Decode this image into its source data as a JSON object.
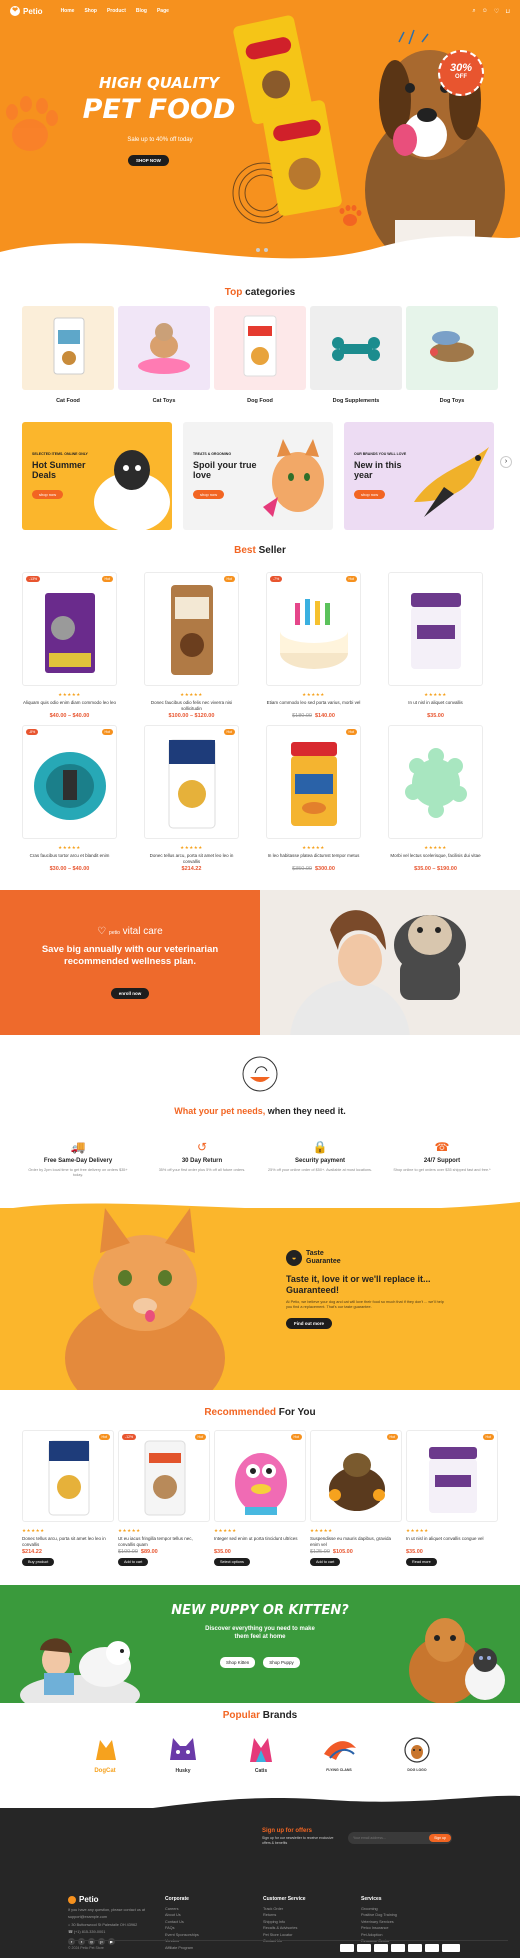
{
  "nav": {
    "logo": "Petio",
    "menu": [
      "Home",
      "Shop",
      "Product",
      "Blog",
      "Page"
    ]
  },
  "hero": {
    "title_line1": "HIGH QUALITY",
    "title_line2": "PET FOOD",
    "subtitle": "Sale up to 40% off today",
    "button": "Shop now",
    "badge_percent": "30%",
    "badge_off": "OFF"
  },
  "categories": {
    "title_orange": "Top",
    "title_dark": "categories",
    "items": [
      {
        "label": "Cat Food",
        "color": "#fbeed9"
      },
      {
        "label": "Cat Toys",
        "color": "#f1e6f7"
      },
      {
        "label": "Dog Food",
        "color": "#fde8e9"
      },
      {
        "label": "Dog Supplements",
        "color": "#eeeeee"
      },
      {
        "label": "Dog Toys",
        "color": "#e6f4ea"
      }
    ]
  },
  "banners": [
    {
      "small": "Selected items. Online only",
      "big": "Hot Summer Deals",
      "button": "shop now",
      "color": "#fbb62c"
    },
    {
      "small": "Treats & Grooming",
      "big": "Spoil your true love",
      "button": "shop now",
      "color": "#f3f3f3"
    },
    {
      "small": "Our brands you will love",
      "big": "New in this year",
      "button": "shop now",
      "color": "#eddcf3"
    }
  ],
  "best_seller": {
    "title_orange": "Best",
    "title_dark": "Seller",
    "products": [
      {
        "name": "Aliquam quis odio enim diam commodo leo leo",
        "price": "$40.00 – $40.00",
        "tagL": "-13%",
        "tagR": "Hot"
      },
      {
        "name": "Donec faucibus odio felis nec viverra nisi sollicitudin",
        "price": "$100.00 – $120.00",
        "tagL": "",
        "tagR": "Hot"
      },
      {
        "name": "Etiam commodo leo sed porta varius, morbi vel",
        "old": "$180.00",
        "price": "$140.00",
        "tagL": "-7%",
        "tagR": "Hot"
      },
      {
        "name": "In ut nisl in aliquet convallis",
        "price": "$35.00",
        "tagL": "",
        "tagR": ""
      },
      {
        "name": "Cras faucibus tortor arcu et blandit enim",
        "price": "$30.00 – $40.00",
        "tagL": "-8%",
        "tagR": "Hot"
      },
      {
        "name": "Donec tellus arcu, porta sit amet leo leo in convallis",
        "price": "$214.22",
        "tagL": "",
        "tagR": "Hot"
      },
      {
        "name": "In leo habitasse platea dictumst tempor metus",
        "old": "$350.00",
        "price": "$300.00",
        "tagL": "",
        "tagR": "Hot"
      },
      {
        "name": "Morbi vel lectus scelerisque, facilisis dui vitae",
        "price": "$35.00 – $190.00",
        "tagL": "",
        "tagR": ""
      }
    ]
  },
  "vital": {
    "brand_prefix": "petio",
    "brand": "vital care",
    "text": "Save big annually with our veterinarian recommended wellness plan.",
    "button": "enroll now"
  },
  "needs": {
    "title_orange": "What your pet needs,",
    "title_dark": "when they need it.",
    "features": [
      {
        "icon": "truck-icon",
        "glyph": "🚚",
        "title": "Free Same-Day Delivery",
        "desc": "Order by 2pm local time to get free delivery on orders $35+ today."
      },
      {
        "icon": "return-icon",
        "glyph": "↺",
        "title": "30 Day Return",
        "desc": "35% off your first order plus 5% off all future orders."
      },
      {
        "icon": "lock-icon",
        "glyph": "🔒",
        "title": "Security payment",
        "desc": "25% off your online order of $50+. Available at most locations."
      },
      {
        "icon": "support-icon",
        "glyph": "☎",
        "title": "24/7 Support",
        "desc": "Shop online to get orders over $35 shipped fast and free.*"
      }
    ]
  },
  "taste": {
    "label1": "Taste",
    "label2": "Guarantee",
    "headline": "Taste it, love it or we'll replace it... Guaranteed!",
    "text": "At Petio, we believe your dog and cat will love their food so much that if they don't ... we'll help you find a replacement. That's our taste guarantee.",
    "button": "Find out more"
  },
  "recommended": {
    "title_orange": "Recommended",
    "title_dark": "For You",
    "products": [
      {
        "name": "Donec tellus arcu, porta sit amet leo leo in convallis",
        "price": "$214.22",
        "button": "Buy product",
        "tagL": "",
        "tagR": "Hot"
      },
      {
        "name": "Ut eu iacus fringilla tempor tellus nec, convallis quam",
        "old": "$100.00",
        "price": "$89.00",
        "button": "Add to cart",
        "tagL": "-12%",
        "tagR": "Hot"
      },
      {
        "name": "Integer sed enim ut porta tincidunt ultrices",
        "price": "$35.00",
        "button": "Select options",
        "tagL": "",
        "tagR": "Hot"
      },
      {
        "name": "Suspendisse eu mauris dapibus, gravida enim vel",
        "old": "$125.00",
        "price": "$105.00",
        "button": "Add to cart",
        "tagL": "",
        "tagR": "Hot"
      },
      {
        "name": "In ut nisl in aliquet convallis congue vel",
        "price": "$35.00",
        "button": "Read more",
        "tagL": "",
        "tagR": "Hot"
      }
    ]
  },
  "puppy": {
    "title": "NEW PUPPY OR KITTEN?",
    "sub": "Discover everything you need to make them feel at home",
    "btn1": "Shop Kitten",
    "btn2": "Shop Puppy"
  },
  "brands": {
    "title_orange": "Popular",
    "title_dark": "Brands",
    "items": [
      "DogCat",
      "Husky",
      "Catis",
      "FLYING CLANS",
      "DOG LOGO"
    ]
  },
  "footer": {
    "newsletter_title": "Sign up for offers",
    "newsletter_text": "Sign up for our newsletter to receive exclusive offers & benefits",
    "email_placeholder": "Your email address...",
    "email_button": "Sign up",
    "logo": "Petio",
    "about": "If you have any question, please contact us at support@example.com",
    "address": "30 Buttonwood St Palestaile OH 43962",
    "phone": "(+1) 815-339-0001",
    "corporate_title": "Corporate",
    "corporate": [
      "Careers",
      "About Us",
      "Contact Us",
      "FAQs",
      "Event Sponsorships",
      "Vendors",
      "Affiliate Program"
    ],
    "customer_title": "Customer Service",
    "customer": [
      "Track Order",
      "Returns",
      "Shipping Info",
      "Recalls & Advisories",
      "Pet Store Locator",
      "Contact Us"
    ],
    "services_title": "Services",
    "services": [
      "Grooming",
      "Positive Dog Training",
      "Veterinary Services",
      "Petco Insurance",
      "Pet Adoption",
      "Resource Center"
    ],
    "copyright": "© 2024 Petio Pet Store"
  }
}
